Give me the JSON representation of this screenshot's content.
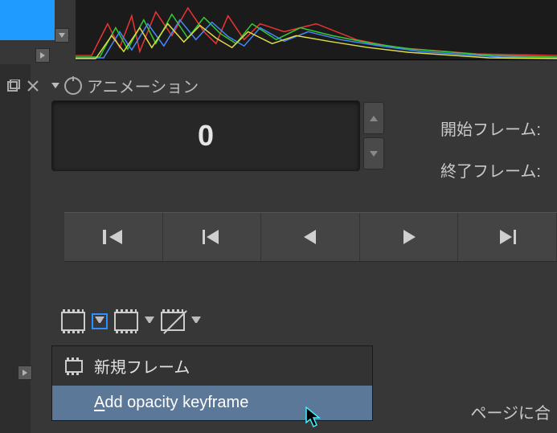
{
  "dock": {
    "title": "アニメーション"
  },
  "frame": {
    "current": "0",
    "start_label": "開始フレーム:",
    "end_label": "終了フレーム:"
  },
  "menu": {
    "items": [
      {
        "label": "新規フレーム",
        "icon": "film-icon"
      },
      {
        "label": "Add opacity keyframe",
        "icon": "",
        "mnemonic_first": "A"
      }
    ]
  },
  "footer": {
    "fit_label": "ページに合"
  }
}
